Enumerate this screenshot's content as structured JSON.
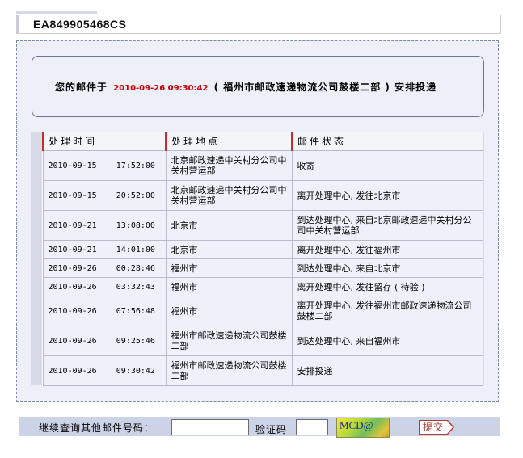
{
  "tracking_number": "EA849905468CS",
  "summary": {
    "prefix": "您的邮件于",
    "timestamp": "2010-09-26 09:30:42",
    "suffix": "( 福州市邮政速递物流公司鼓楼二部 ) 安排投递"
  },
  "table": {
    "headers": [
      "处理时间",
      "处理地点",
      "邮件状态"
    ],
    "rows": [
      {
        "time": "2010-09-15    17:52:00",
        "place": "北京邮政速递中关村分公司中关村营运部",
        "status": "收寄"
      },
      {
        "time": "2010-09-15    20:52:00",
        "place": "北京邮政速递中关村分公司中关村营运部",
        "status": "离开处理中心, 发往北京市"
      },
      {
        "time": "2010-09-21    13:08:00",
        "place": "北京市",
        "status": "到达处理中心, 来自北京邮政速递中关村分公司中关村营运部"
      },
      {
        "time": "2010-09-21    14:01:00",
        "place": "北京市",
        "status": "离开处理中心, 发往福州市"
      },
      {
        "time": "2010-09-26    00:28:46",
        "place": "福州市",
        "status": "到达处理中心, 来自北京市"
      },
      {
        "time": "2010-09-26    03:32:43",
        "place": "福州市",
        "status": "离开处理中心, 发往留存 ( 待验 )"
      },
      {
        "time": "2010-09-26    07:56:48",
        "place": "福州市",
        "status": "离开处理中心, 发往福州市邮政速递物流公司鼓楼二部"
      },
      {
        "time": "2010-09-26    09:25:46",
        "place": "福州市邮政速递物流公司鼓楼二部",
        "status": "到达处理中心, 来自福州市"
      },
      {
        "time": "2010-09-26    09:30:42",
        "place": "福州市邮政速递物流公司鼓楼二部",
        "status": "安排投递"
      }
    ]
  },
  "query": {
    "label": "继续查询其他邮件号码：",
    "tracking_value": "",
    "captcha_label": "验证码",
    "captcha_value": "",
    "captcha_text": "MCD@",
    "submit_label": "提交"
  },
  "colors": {
    "accent_red": "#cc0000",
    "panel_bg": "#edf0f8",
    "header_marker": "#c62c2c"
  }
}
